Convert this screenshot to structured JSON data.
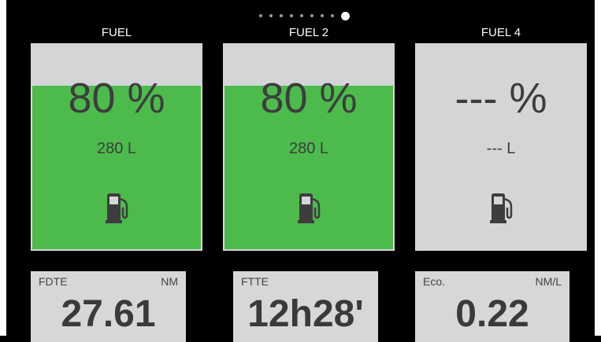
{
  "pager": {
    "total": 9,
    "active_index": 8
  },
  "tanks": [
    {
      "title": "FUEL",
      "percent_text": "80 %",
      "volume_text": "280 L",
      "level": 0.8,
      "icon": "fuel-pump-icon"
    },
    {
      "title": "FUEL 2",
      "percent_text": "80 %",
      "volume_text": "280 L",
      "level": 0.8,
      "icon": "fuel-pump-icon"
    },
    {
      "title": "FUEL 4",
      "percent_text": "--- %",
      "volume_text": "--- L",
      "level": 0,
      "icon": "fuel-pump-icon"
    }
  ],
  "info": [
    {
      "label": "FDTE",
      "unit": "NM",
      "value": "27.61"
    },
    {
      "label": "FTTE",
      "unit": "",
      "value": "12h28'"
    },
    {
      "label": "Eco.",
      "unit": "NM/L",
      "value": "0.22"
    }
  ],
  "colors": {
    "background": "#000000",
    "tank_empty": "#d4d5d7",
    "fuel_fill": "#4cbb4c",
    "text_dark": "#3d3d3d",
    "dot_inactive": "#9a9a9a",
    "dot_active": "#ffffff"
  }
}
